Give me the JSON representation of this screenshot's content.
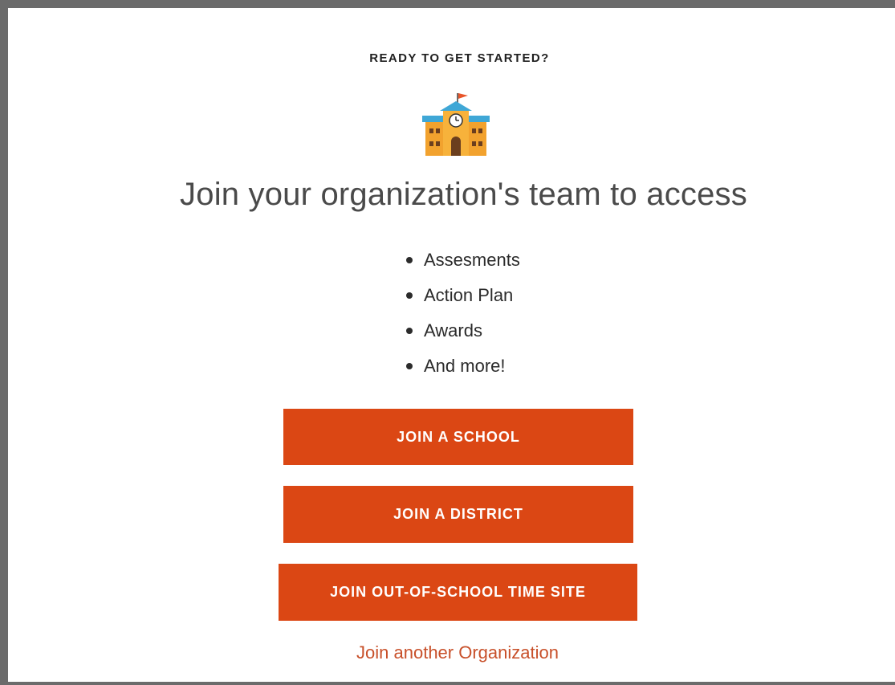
{
  "card": {
    "eyebrow": "READY TO GET STARTED?",
    "icon": "school-building-icon",
    "headline": "Join your organization's team to access",
    "features": [
      {
        "label": "Assesments"
      },
      {
        "label": "Action Plan"
      },
      {
        "label": "Awards"
      },
      {
        "label": "And more!"
      }
    ],
    "buttons": {
      "join_school": "JOIN A SCHOOL",
      "join_district": "JOIN A DISTRICT",
      "join_ost": "JOIN OUT-OF-SCHOOL TIME SITE"
    },
    "link_other": "Join another Organization"
  },
  "colors": {
    "accent": "#db4714",
    "link": "#c8502a",
    "frame": "#6b6b6b"
  }
}
